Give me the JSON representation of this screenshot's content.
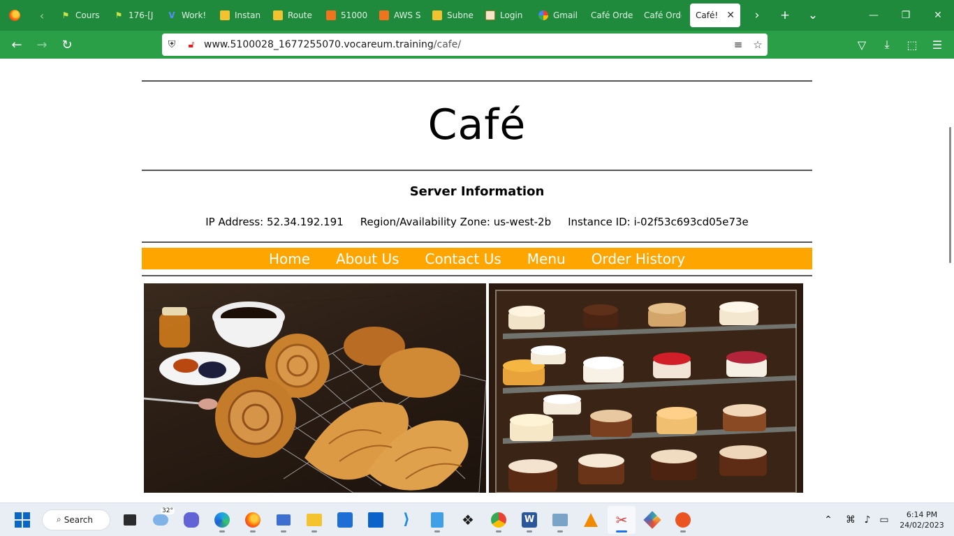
{
  "browser": {
    "tabs": [
      {
        "label": "Cours",
        "icon": "graduation-icon",
        "color": "#5b3b1d"
      },
      {
        "label": "176-[J",
        "icon": "graduation-icon",
        "color": "#5b3b1d"
      },
      {
        "label": "Work!",
        "icon": "vocareum-icon",
        "color": "#3b6dd8"
      },
      {
        "label": "Instan",
        "icon": "aws-cube-icon",
        "color": "#f2a623"
      },
      {
        "label": "Route",
        "icon": "aws-cube-icon",
        "color": "#f2a623"
      },
      {
        "label": "51000",
        "icon": "aws-orange-icon",
        "color": "#e8691c"
      },
      {
        "label": "AWS S",
        "icon": "aws-orange-icon",
        "color": "#e8691c"
      },
      {
        "label": "Subne",
        "icon": "aws-cube-icon",
        "color": "#f2a623"
      },
      {
        "label": "Login",
        "icon": "login-icon",
        "color": "#c58b2b"
      },
      {
        "label": "Gmail",
        "icon": "google-icon",
        "color": "#ffffff"
      },
      {
        "label": "Café Orde",
        "icon": "",
        "color": ""
      },
      {
        "label": "Café Orde",
        "icon": "",
        "color": ""
      }
    ],
    "active_tab": {
      "label": "Café!"
    },
    "url_domain": "www.5100028_1677255070.vocareum.training",
    "url_path": "/cafe/"
  },
  "page": {
    "title": "Café",
    "server_heading": "Server Information",
    "ip_address": "IP Address: 52.34.192.191",
    "region": "Region/Availability Zone: us-west-2b",
    "instance_id": "Instance ID: i-02f53c693cd05e73e",
    "menu": [
      "Home",
      "About Us",
      "Contact Us",
      "Menu",
      "Order History"
    ],
    "accent_color": "#ffa500"
  },
  "taskbar": {
    "search_label": "Search",
    "weather_temp": "32°",
    "time": "6:14 PM",
    "date": "24/02/2023"
  }
}
